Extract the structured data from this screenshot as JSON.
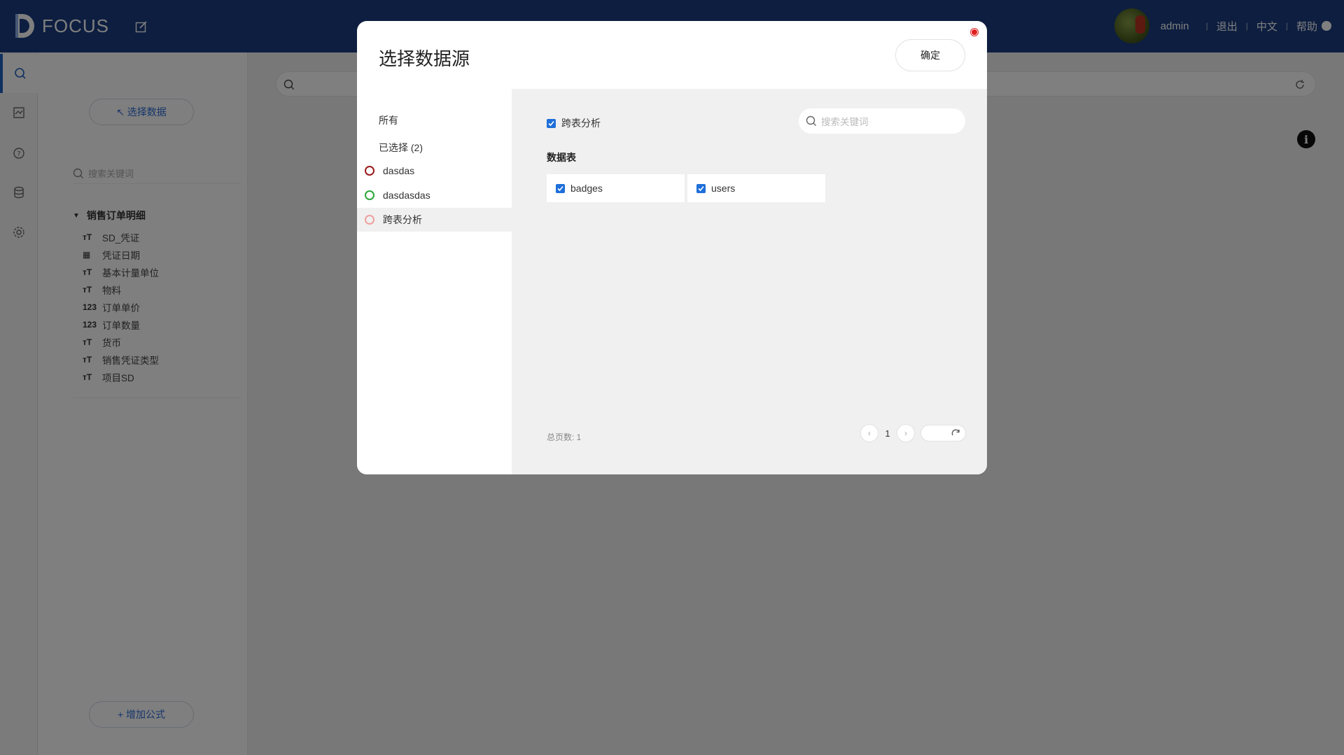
{
  "app": {
    "brand": "FOCUS",
    "user": "admin",
    "logout": "退出",
    "language": "中文",
    "help": "帮助"
  },
  "sidebar": {
    "select_data_label": "↖ 选择数据",
    "search_placeholder": "搜索关键词",
    "table_name": "销售订单明细",
    "fields": [
      {
        "type": "T",
        "name": "SD_凭证"
      },
      {
        "type": "date",
        "name": "凭证日期"
      },
      {
        "type": "T",
        "name": "基本计量单位"
      },
      {
        "type": "T",
        "name": "物料"
      },
      {
        "type": "123",
        "name": "订单单价"
      },
      {
        "type": "123",
        "name": "订单数量"
      },
      {
        "type": "T",
        "name": "货币"
      },
      {
        "type": "T",
        "name": "销售凭证类型"
      },
      {
        "type": "T",
        "name": "项目SD"
      }
    ],
    "add_formula_label": "+ 增加公式"
  },
  "rail": {
    "icons": [
      "search-icon",
      "dashboard-icon",
      "help-icon",
      "database-icon",
      "settings-icon"
    ]
  },
  "modal": {
    "title": "选择数据源",
    "confirm": "确定",
    "filters": {
      "all": "所有",
      "selected": "已选择 (2)"
    },
    "sources": [
      {
        "name": "dasdas",
        "color": "#9b1a1a"
      },
      {
        "name": "dasdasdas",
        "color": "#2aa83a"
      },
      {
        "name": "跨表分析",
        "color": "#f0a0a0"
      }
    ],
    "current_source": "跨表分析",
    "search_placeholder": "搜索关键词",
    "section_label": "数据表",
    "tables": [
      "badges",
      "users"
    ],
    "total_pages": "总页数: 1",
    "page": "1"
  }
}
